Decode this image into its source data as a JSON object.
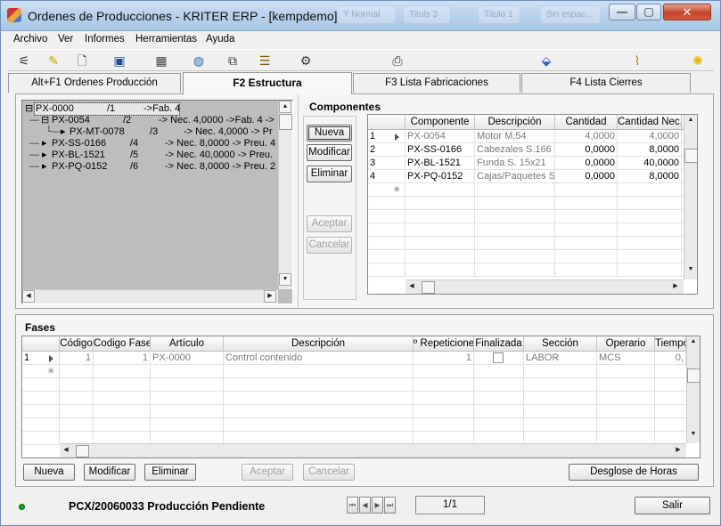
{
  "window": {
    "title": "Ordenes de Producciones - KRITER ERP - [kempdemo]",
    "ghost_tabs": [
      "Y Normal",
      "Tituls 3",
      "Titulo 1",
      "Sin espac..."
    ],
    "minimize": "—",
    "maximize": "▢",
    "close": "✕"
  },
  "menu": [
    "Archivo",
    "Ver",
    "Informes",
    "Herramientas",
    "Ayuda"
  ],
  "toolbar_icons": [
    "tree-icon",
    "highlighter-icon",
    "preview-icon",
    "search-window-icon",
    "calculator-icon",
    "globe-icon",
    "document-copy-icon",
    "checklist-icon",
    "tools-icon",
    "printer-icon",
    "eraser-icon",
    "paperclip-icon",
    "lightbulb-icon"
  ],
  "tabs": [
    {
      "label": "Alt+F1 Ordenes Producción",
      "active": false
    },
    {
      "label": "F2 Estructura",
      "active": true
    },
    {
      "label": "F3 Lista Fabricaciones",
      "active": false
    },
    {
      "label": "F4 Lista Cierres",
      "active": false
    }
  ],
  "tree": [
    {
      "expander": "⊟",
      "code": "PX-0000",
      "level_ref": "/1",
      "detail": "->Fab. 4"
    },
    {
      "expander": "⊟",
      "code": "PX-0054",
      "level_ref": "/2",
      "detail": "-> Nec. 4,0000 ->Fab. 4 ->"
    },
    {
      "expander": "▸",
      "code": "PX-MT-0078",
      "level_ref": "/3",
      "detail": "-> Nec. 4,0000 -> Pr"
    },
    {
      "expander": "▸",
      "code": "PX-SS-0166",
      "level_ref": "/4",
      "detail": "-> Nec. 8,0000 -> Preu. 4"
    },
    {
      "expander": "▸",
      "code": "PX-BL-1521",
      "level_ref": "/5",
      "detail": "-> Nec. 40,0000 -> Preu."
    },
    {
      "expander": "▸",
      "code": "PX-PQ-0152",
      "level_ref": "/6",
      "detail": "-> Nec. 8,0000 -> Preu. 2"
    }
  ],
  "componentes": {
    "title": "Componentes",
    "buttons": {
      "nueva": "Nueva",
      "modificar": "Modificar",
      "eliminar": "Eliminar",
      "aceptar": "Aceptar",
      "cancelar": "Cancelar"
    },
    "columns": [
      "Componente",
      "Descripción",
      "Cantidad",
      "Cantidad Nec."
    ],
    "rows": [
      {
        "n": "1",
        "componente": "PX-0054",
        "descripcion": "Motor M.54",
        "cantidad": "4,0000",
        "cantidad_nec": "4,0000"
      },
      {
        "n": "2",
        "componente": "PX-SS-0166",
        "descripcion": "Cabezales S.166",
        "cantidad": "0,0000",
        "cantidad_nec": "8,0000"
      },
      {
        "n": "3",
        "componente": "PX-BL-1521",
        "descripcion": "Funda S. 15x21",
        "cantidad": "0,0000",
        "cantidad_nec": "40,0000"
      },
      {
        "n": "4",
        "componente": "PX-PQ-0152",
        "descripcion": "Cajas/Paquetes S",
        "cantidad": "0,0000",
        "cantidad_nec": "8,0000"
      }
    ]
  },
  "fases": {
    "title": "Fases",
    "columns": [
      "Código",
      "Codigo Fase",
      "Artículo",
      "Descripción",
      "º Repeticione",
      "Finalizada",
      "Sección",
      "Operario",
      "Tiempo"
    ],
    "rows": [
      {
        "n": "1",
        "codigo": "1",
        "codigo_fase": "1",
        "articulo": "PX-0000",
        "descripcion": "Control contenido",
        "repeticiones": "1",
        "finalizada": false,
        "seccion": "LABOR",
        "operario": "MCS",
        "tiempo": "0,"
      }
    ],
    "buttons": {
      "nueva": "Nueva",
      "modificar": "Modificar",
      "eliminar": "Eliminar",
      "aceptar": "Aceptar",
      "cancelar": "Cancelar",
      "desglose": "Desglose de Horas"
    }
  },
  "status": {
    "text": "PCX/20060033 Producción Pendiente",
    "record": "1/1",
    "salir": "Salir",
    "indicator_color": "#18a518"
  }
}
